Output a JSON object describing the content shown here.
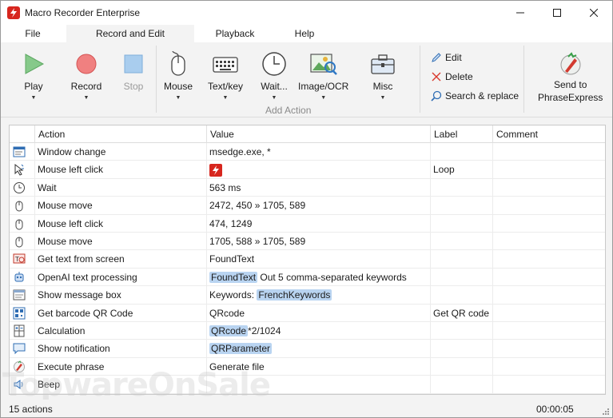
{
  "app": {
    "title": "Macro Recorder Enterprise"
  },
  "menu": {
    "tabs": [
      "File",
      "Record and Edit",
      "Playback",
      "Help"
    ],
    "active": "Record and Edit"
  },
  "ribbon": {
    "play": "Play",
    "record": "Record",
    "stop": "Stop",
    "mouse": "Mouse",
    "textkey": "Text/key",
    "wait": "Wait...",
    "image_ocr": "Image/OCR",
    "misc": "Misc",
    "group_label": "Add Action",
    "edit": "Edit",
    "delete": "Delete",
    "search_replace": "Search & replace",
    "send_to": "Send to",
    "phraseexpress": "PhraseExpress"
  },
  "table": {
    "columns": [
      "Action",
      "Value",
      "Label",
      "Comment"
    ],
    "rows": [
      {
        "icon": "window-change-icon",
        "action": "Window change",
        "value": "msedge.exe, *",
        "label": ""
      },
      {
        "icon": "mouse-click-icon",
        "action": "Mouse left click",
        "value": "",
        "value_icon": true,
        "label": "Loop"
      },
      {
        "icon": "clock-icon",
        "action": "Wait",
        "value": "563 ms",
        "label": ""
      },
      {
        "icon": "mouse-icon",
        "action": "Mouse move",
        "value": "2472, 450 » 1705, 589",
        "label": ""
      },
      {
        "icon": "mouse-icon",
        "action": "Mouse left click",
        "value": "474, 1249",
        "label": ""
      },
      {
        "icon": "mouse-icon",
        "action": "Mouse move",
        "value": "1705, 588 » 1705, 589",
        "label": ""
      },
      {
        "icon": "screen-text-icon",
        "action": "Get text from screen",
        "value": "FoundText",
        "label": ""
      },
      {
        "icon": "robot-icon",
        "action": "OpenAI text processing",
        "value_chip": "FoundText",
        "value_rest": " Out 5 comma-separated keywords",
        "label": ""
      },
      {
        "icon": "message-box-icon",
        "action": "Show message box",
        "value_prefix": "Keywords: ",
        "value_chip": "FrenchKeywords",
        "label": ""
      },
      {
        "icon": "qr-code-icon",
        "action": "Get barcode QR Code",
        "value": "QRcode",
        "label": "Get QR code"
      },
      {
        "icon": "calculator-icon",
        "action": "Calculation",
        "value_chip": "QRcode",
        "value_rest": "*2/1024",
        "label": ""
      },
      {
        "icon": "notification-icon",
        "action": "Show notification",
        "value_chip": "QRParameter",
        "label": ""
      },
      {
        "icon": "phrase-icon",
        "action": "Execute phrase",
        "value": "Generate file",
        "label": ""
      },
      {
        "icon": "speaker-icon",
        "action": "Beep",
        "value": "",
        "label": ""
      }
    ]
  },
  "status": {
    "count": "15 actions",
    "time": "00:00:05"
  },
  "watermark": "TopwareOnSale"
}
